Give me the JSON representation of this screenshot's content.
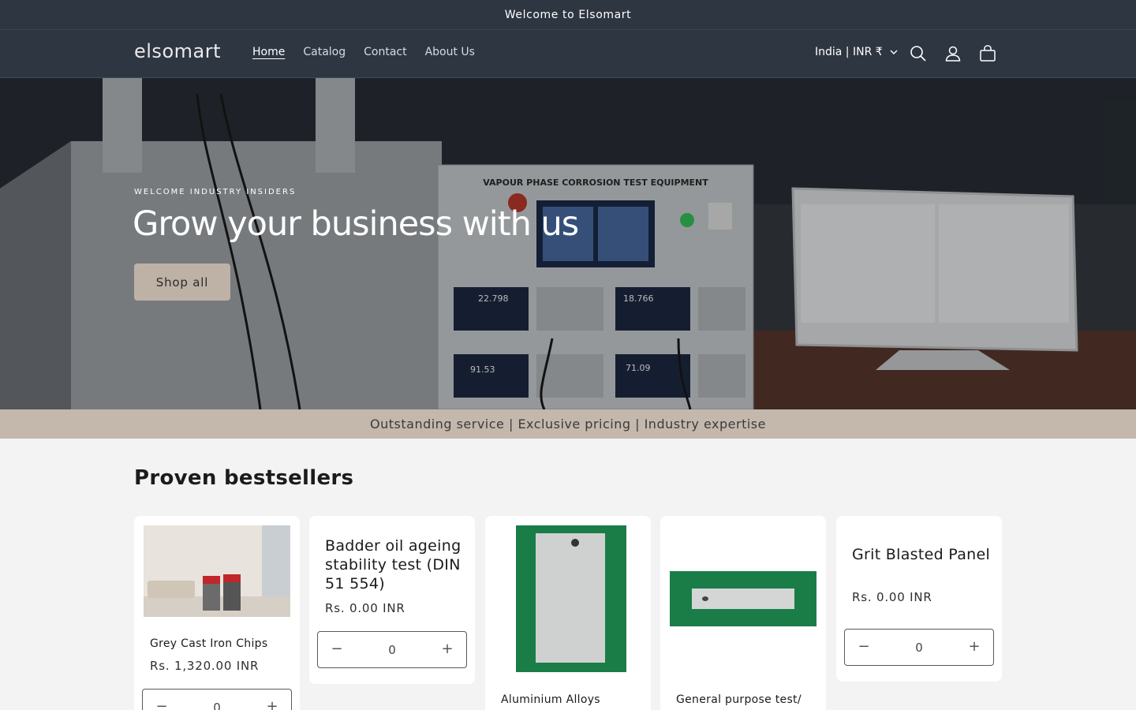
{
  "announcement": "Welcome to Elsomart",
  "header": {
    "logo": "elsomart",
    "nav": [
      "Home",
      "Catalog",
      "Contact",
      "About Us"
    ],
    "country": "India | INR ₹",
    "icons": [
      "search-icon",
      "account-icon",
      "cart-icon"
    ]
  },
  "hero": {
    "eyebrow": "WELCOME INDUSTRY INSIDERS",
    "heading": "Grow your business with us",
    "button": "Shop all",
    "image_text": {
      "panel_title": "VAPOUR PHASE CORROSION TEST EQUIPMENT",
      "meter_values": [
        "22.798",
        "18.766",
        "91.53",
        "71.09"
      ]
    }
  },
  "strip": "Outstanding service | Exclusive pricing | Industry expertise",
  "bestsellers": {
    "title": "Proven bestsellers",
    "products": [
      {
        "title": "Grey Cast Iron Chips",
        "price": "Rs. 1,320.00 INR",
        "qty": "0"
      },
      {
        "title": "Badder oil ageing stability test (DIN 51 554)",
        "price": "Rs. 0.00 INR",
        "qty": "0"
      },
      {
        "title": "Aluminium Alloys",
        "price": "",
        "qty": ""
      },
      {
        "title": "General purpose test/",
        "price": "",
        "qty": ""
      },
      {
        "title": "Grit Blasted Panel",
        "price": "Rs. 0.00 INR",
        "qty": "0"
      }
    ]
  },
  "colors": {
    "header_bg": "#2e3642",
    "button_bg": "#beb1a6",
    "strip_bg": "#c4b8ad",
    "page_bg": "#f3f3f3"
  }
}
